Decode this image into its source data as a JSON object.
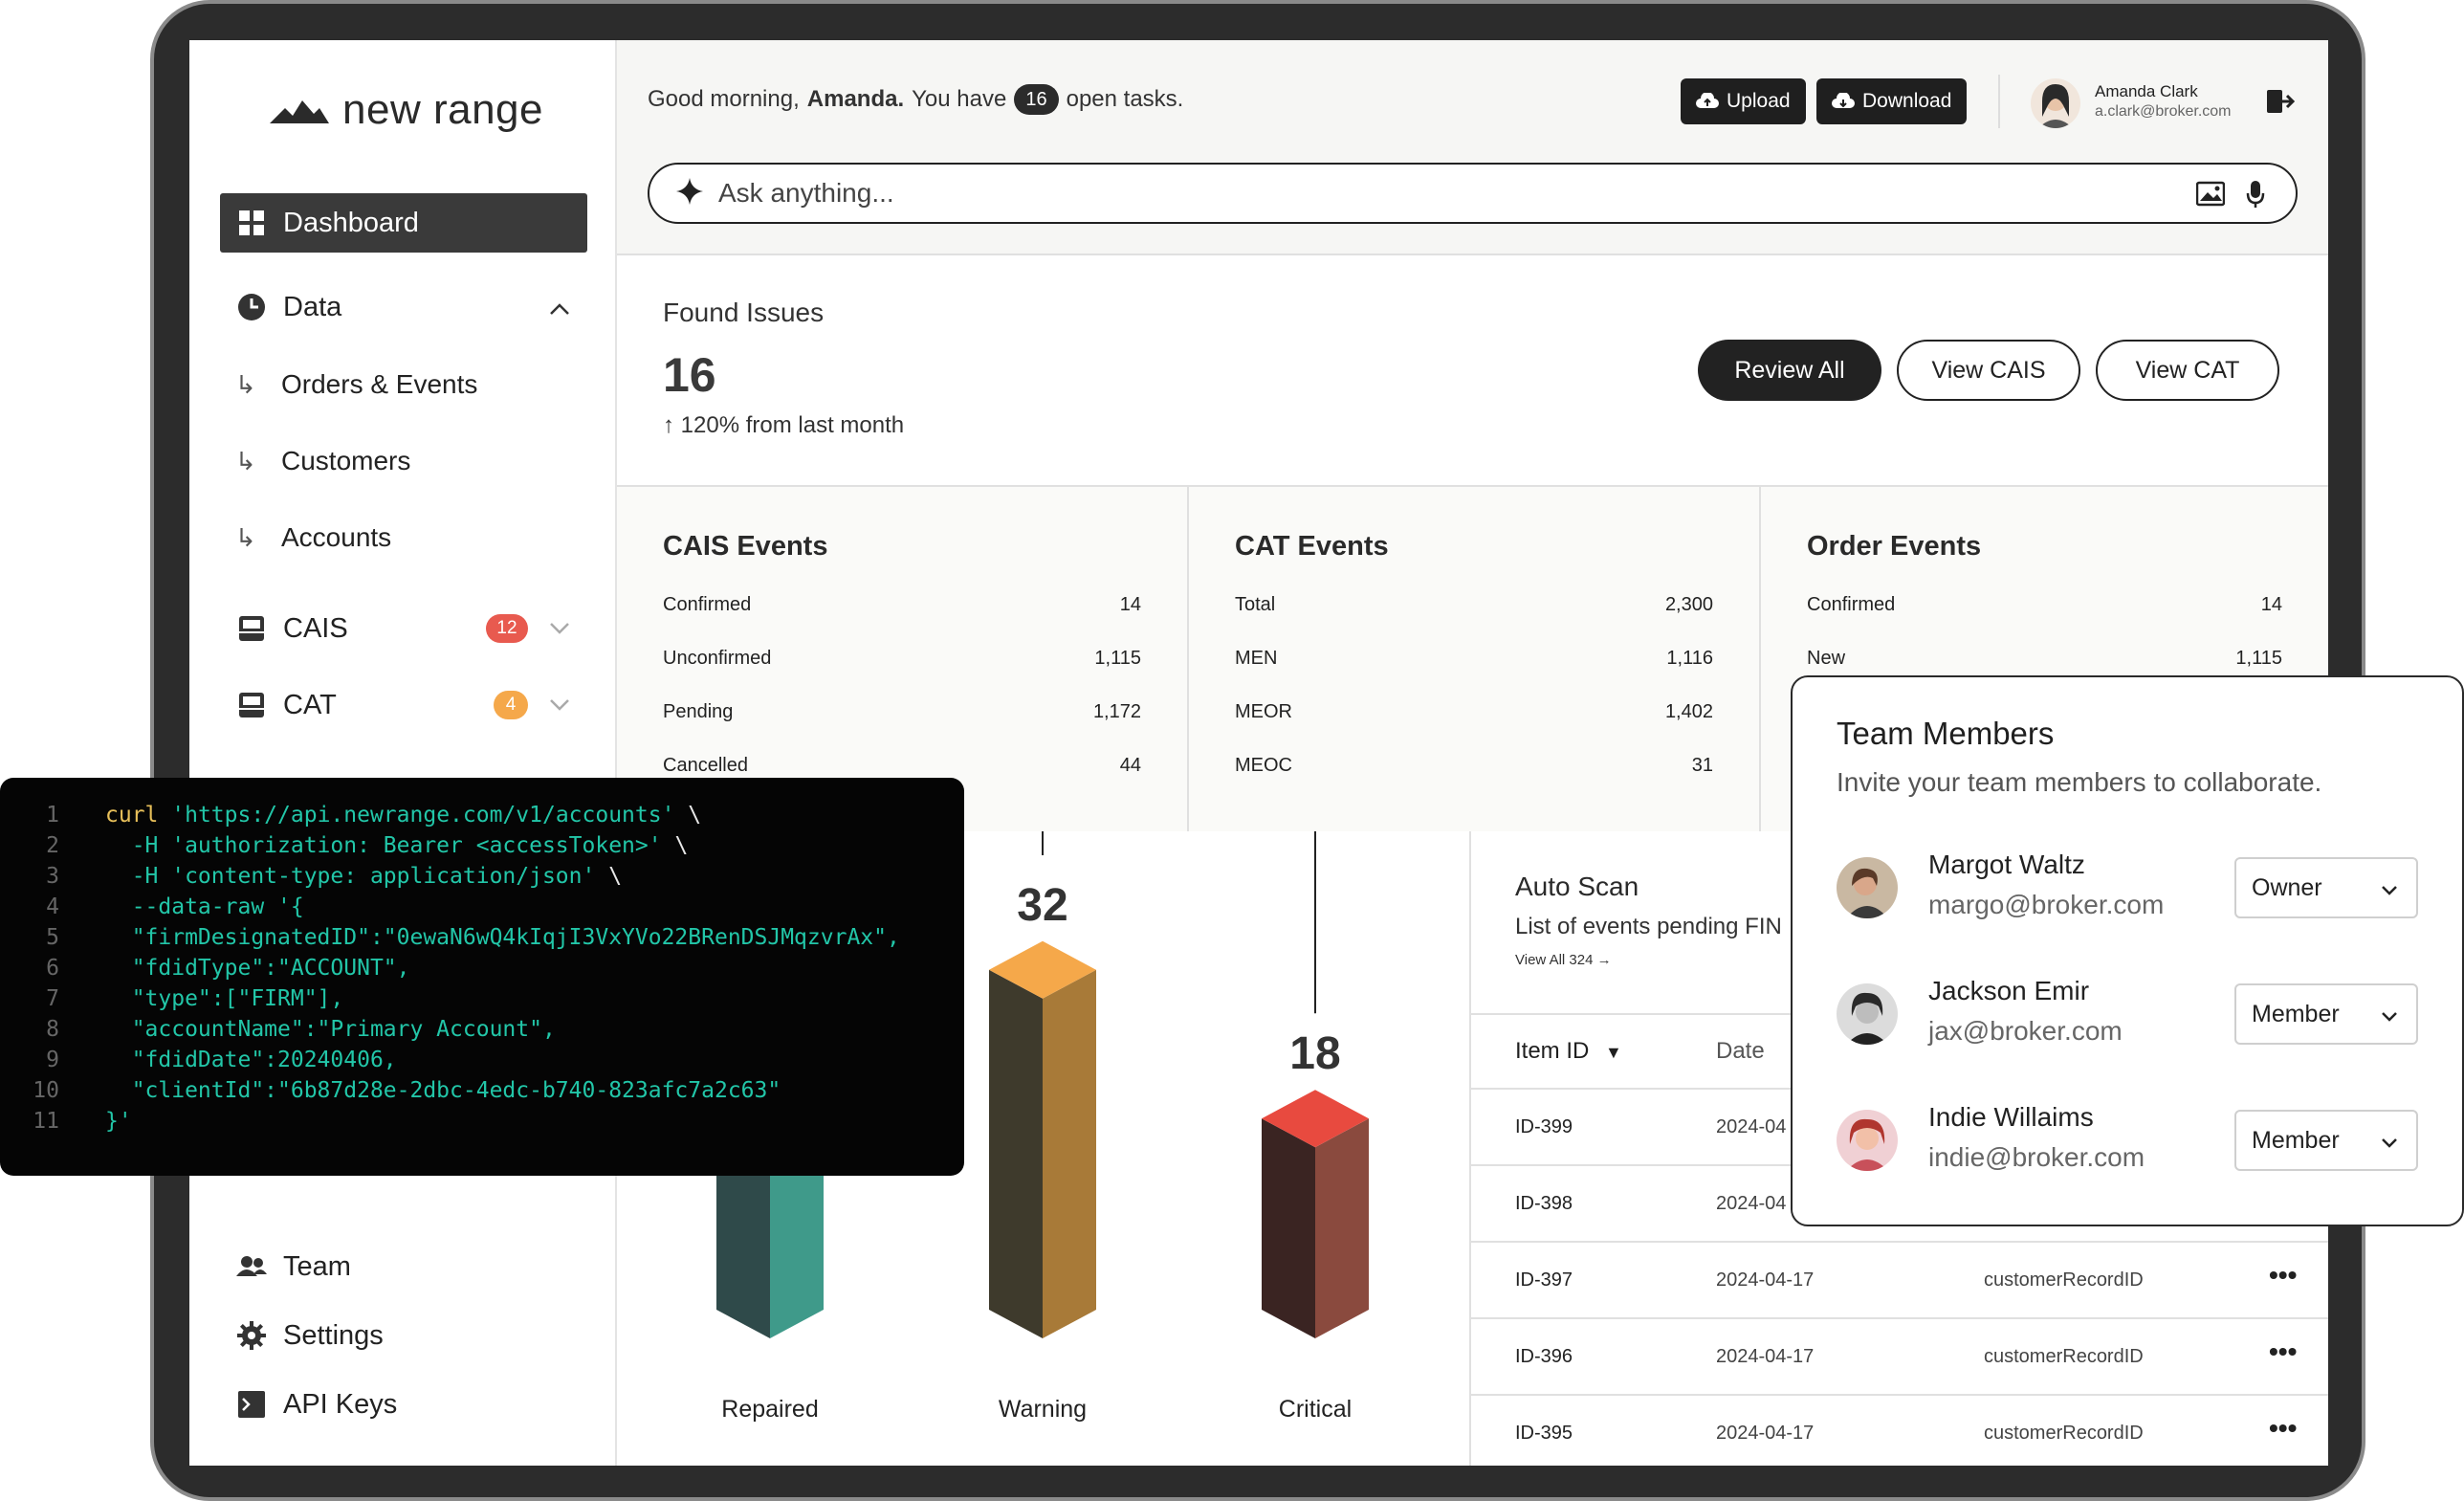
{
  "app": {
    "name": "new range"
  },
  "sidebar": {
    "dashboard": "Dashboard",
    "data": "Data",
    "sub": [
      "Orders & Events",
      "Customers",
      "Accounts"
    ],
    "cais": {
      "label": "CAIS",
      "count": "12",
      "color": "#e85a4f"
    },
    "cat": {
      "label": "CAT",
      "count": "4",
      "color": "#f5a84a"
    },
    "team": "Team",
    "settings": "Settings",
    "api_keys": "API Keys"
  },
  "header": {
    "greeting_pre": "Good morning,",
    "user_first": "Amanda.",
    "greeting_mid": "You have",
    "open_tasks": "16",
    "greeting_post": "open tasks.",
    "upload": "Upload",
    "download": "Download",
    "user_name": "Amanda Clark",
    "user_email": "a.clark@broker.com",
    "ask_placeholder": "Ask anything..."
  },
  "issues": {
    "title": "Found Issues",
    "count": "16",
    "delta": "120% from last month",
    "review_all": "Review All",
    "view_cais": "View CAIS",
    "view_cat": "View CAT"
  },
  "cards": [
    {
      "title": "CAIS Events",
      "rows": [
        [
          "Confirmed",
          "14"
        ],
        [
          "Unconfirmed",
          "1,115"
        ],
        [
          "Pending",
          "1,172"
        ],
        [
          "Cancelled",
          "44"
        ]
      ]
    },
    {
      "title": "CAT Events",
      "rows": [
        [
          "Total",
          "2,300"
        ],
        [
          "MEN",
          "1,116"
        ],
        [
          "MEOR",
          "1,402"
        ],
        [
          "MEOC",
          "31"
        ]
      ]
    },
    {
      "title": "Order Events",
      "rows": [
        [
          "Confirmed",
          "14"
        ],
        [
          "New",
          "1,115"
        ]
      ]
    }
  ],
  "chart_data": {
    "type": "bar",
    "categories": [
      "Repaired",
      "Warning",
      "Critical"
    ],
    "values": [
      null,
      32,
      18
    ],
    "value_labels": [
      "",
      "32",
      "18"
    ],
    "colors": [
      {
        "top": "#2ff5d8",
        "left": "#2f4a4a",
        "right": "#3f9a8a"
      },
      {
        "top": "#f5a84a",
        "left": "#3e3a2c",
        "right": "#a87a38"
      },
      {
        "top": "#e84a3f",
        "left": "#3a2422",
        "right": "#8a4a3e"
      }
    ]
  },
  "scan": {
    "title": "Auto Scan",
    "subtitle": "List of events pending FIN",
    "view_all": "View All 324 →",
    "headers": [
      "Item ID",
      "Date"
    ],
    "rows": [
      {
        "id": "ID-399",
        "date": "2024-04",
        "field": ""
      },
      {
        "id": "ID-398",
        "date": "2024-04",
        "field": ""
      },
      {
        "id": "ID-397",
        "date": "2024-04-17",
        "field": "customerRecordID"
      },
      {
        "id": "ID-396",
        "date": "2024-04-17",
        "field": "customerRecordID"
      },
      {
        "id": "ID-395",
        "date": "2024-04-17",
        "field": "customerRecordID"
      }
    ]
  },
  "code": {
    "lines": [
      [
        "1",
        "curl 'https://api.newrange.com/v1/accounts' \\"
      ],
      [
        "2",
        "  -H 'authorization: Bearer <accessToken>' \\"
      ],
      [
        "3",
        "  -H 'content-type: application/json' \\"
      ],
      [
        "4",
        "  --data-raw '{"
      ],
      [
        "5",
        "  \"firmDesignatedID\":\"0ewaN6wQ4kIqjI3VxYVo22BRenDSJMqzvrAx\","
      ],
      [
        "6",
        "  \"fdidType\":\"ACCOUNT\","
      ],
      [
        "7",
        "  \"type\":[\"FIRM\"],"
      ],
      [
        "8",
        "  \"accountName\":\"Primary Account\","
      ],
      [
        "9",
        "  \"fdidDate\":20240406,"
      ],
      [
        "10",
        "  \"clientId\":\"6b87d28e-2dbc-4edc-b740-823afc7a2c63\""
      ],
      [
        "11",
        "}'"
      ]
    ]
  },
  "team": {
    "title": "Team Members",
    "subtitle": "Invite your team members to collaborate.",
    "members": [
      {
        "name": "Margot Waltz",
        "email": "margo@broker.com",
        "role": "Owner"
      },
      {
        "name": "Jackson Emir",
        "email": "jax@broker.com",
        "role": "Member"
      },
      {
        "name": "Indie Willaims",
        "email": "indie@broker.com",
        "role": "Member"
      }
    ]
  }
}
